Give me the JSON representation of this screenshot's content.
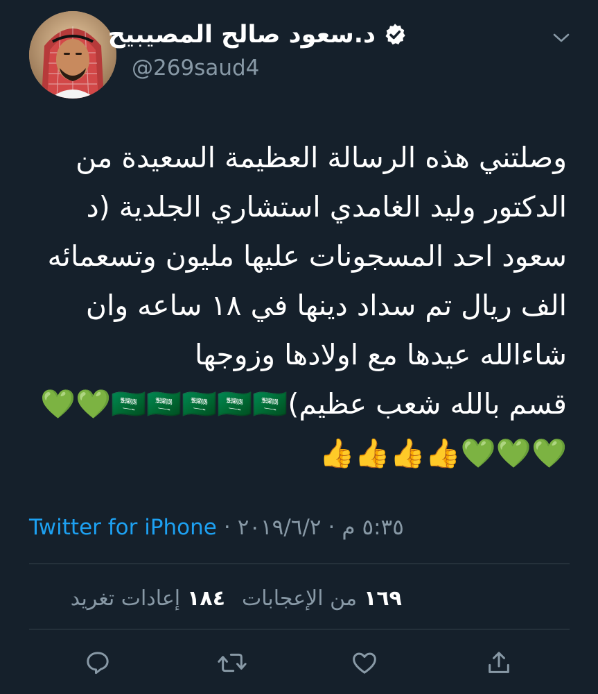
{
  "author": {
    "display_name": "د.سعود صالح المصيبيح",
    "handle": "@269saud4",
    "verified": true
  },
  "tweet": {
    "text": "وصلتني هذه الرسالة العظيمة السعيدة من\nالدكتور وليد الغامدي استشاري الجلدية (د\nسعود احد المسجونات عليها مليون وتسعمائه\nالف ريال تم سداد دينها في ١٨ ساعه وان\nشاءالله عيدها مع اولادها وزوجها\nقسم بالله شعب عظيم)🇸🇦🇸🇦🇸🇦🇸🇦🇸🇦💚💚\n💚💚💚👍👍👍👍",
    "time": "٥:٣٥ م",
    "date": "٢٠١٩/٦/٢",
    "source": "Twitter for iPhone",
    "separator": "·"
  },
  "stats": {
    "retweets_count": "١٨٤",
    "retweets_label": "إعادات تغريد",
    "likes_count": "١٦٩",
    "likes_label": "من الإعجابات"
  },
  "actions": {
    "reply_icon": "reply-icon",
    "retweet_icon": "retweet-icon",
    "like_icon": "heart-icon",
    "share_icon": "share-icon"
  },
  "colors": {
    "background": "#15202b",
    "text": "#ffffff",
    "secondary": "#8899a6",
    "accent": "#1da1f2",
    "divider": "#38444d"
  }
}
